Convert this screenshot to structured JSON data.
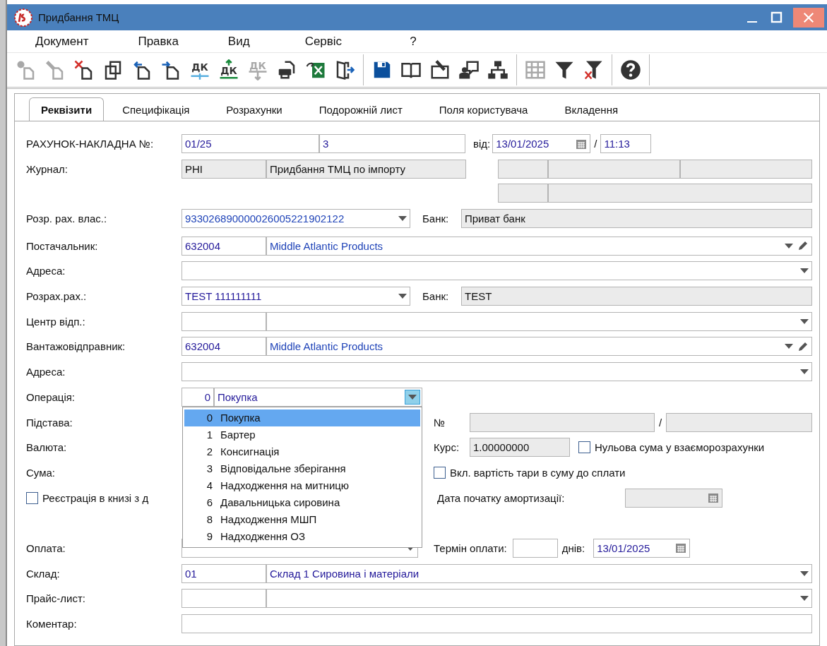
{
  "window": {
    "title": "Придбання ТМЦ"
  },
  "menu": [
    "Документ",
    "Правка",
    "Вид",
    "Сервіс",
    "?"
  ],
  "toolbar": [
    {
      "kind": "new",
      "disabled": true
    },
    {
      "kind": "edit",
      "disabled": true
    },
    {
      "kind": "delete",
      "disabled": false
    },
    {
      "kind": "copy",
      "disabled": false
    },
    {
      "kind": "import",
      "disabled": false
    },
    {
      "kind": "export",
      "disabled": false
    },
    {
      "kind": "dk-split",
      "label": "ДК",
      "disabled": false
    },
    {
      "kind": "dk-up",
      "label": "ДК",
      "disabled": false
    },
    {
      "kind": "dk-down",
      "label": "ДК",
      "disabled": true
    },
    {
      "kind": "print",
      "disabled": false
    },
    {
      "kind": "excel",
      "disabled": false
    },
    {
      "kind": "exit",
      "disabled": false
    },
    {
      "kind": "separator"
    },
    {
      "kind": "save",
      "disabled": false
    },
    {
      "kind": "book",
      "disabled": false
    },
    {
      "kind": "edit-doc",
      "disabled": false
    },
    {
      "kind": "comment",
      "disabled": false
    },
    {
      "kind": "hierarchy",
      "disabled": false
    },
    {
      "kind": "separator"
    },
    {
      "kind": "grid",
      "disabled": true
    },
    {
      "kind": "filter",
      "disabled": false
    },
    {
      "kind": "filter-clear",
      "disabled": false
    },
    {
      "kind": "separator"
    },
    {
      "kind": "help",
      "disabled": false
    },
    {
      "kind": "separator"
    }
  ],
  "tabs": [
    {
      "label": "Реквізити",
      "selected": true
    },
    {
      "label": "Специфікація",
      "selected": false
    },
    {
      "label": "Розрахунки",
      "selected": false
    },
    {
      "label": "Подорожній лист",
      "selected": false
    },
    {
      "label": "Поля користувача",
      "selected": false
    },
    {
      "label": "Вкладення",
      "selected": false
    }
  ],
  "invoice": {
    "label": "РАХУНОК-НАКЛАДНА №:",
    "number": "01/25",
    "suffix": "3",
    "date_label": "від:",
    "date": "13/01/2025",
    "separator": "/",
    "time": "11:13"
  },
  "journal": {
    "label": "Журнал:",
    "code": "РНІ",
    "name": "Придбання ТМЦ по імпорту"
  },
  "own_account": {
    "label": "Розр. рах. влас.:",
    "value": "933026890000026005221902122",
    "bank_label": "Банк:",
    "bank": "Приват банк"
  },
  "supplier": {
    "label": "Постачальник:",
    "code": "632004",
    "name": "Middle Atlantic Products"
  },
  "supplier_address": {
    "label": "Адреса:"
  },
  "account": {
    "label": "Розрах.рах.:",
    "value": "TEST 111111111",
    "bank_label": "Банк:",
    "bank": "TEST"
  },
  "responsibility_center": {
    "label": "Центр відп.:"
  },
  "shipper": {
    "label": "Вантажовідправник:",
    "code": "632004",
    "name": "Middle Atlantic Products"
  },
  "shipper_address": {
    "label": "Адреса:"
  },
  "operation": {
    "label": "Операція:",
    "code": "0",
    "name": "Покупка",
    "expanded": true,
    "options": [
      {
        "code": "0",
        "name": "Покупка",
        "selected": true
      },
      {
        "code": "1",
        "name": "Бартер",
        "selected": false
      },
      {
        "code": "2",
        "name": "Консигнація",
        "selected": false
      },
      {
        "code": "3",
        "name": "Відповідальне зберігання",
        "selected": false
      },
      {
        "code": "4",
        "name": "Надходження на митницю",
        "selected": false
      },
      {
        "code": "6",
        "name": "Давальницька сировина",
        "selected": false
      },
      {
        "code": "8",
        "name": "Надходження МШП",
        "selected": false
      },
      {
        "code": "9",
        "name": "Надходження ОЗ",
        "selected": false
      }
    ]
  },
  "basis": {
    "label": "Підстава:",
    "number_label": "№",
    "separator": "/"
  },
  "currency": {
    "label": "Валюта:",
    "rate_label": "Курс:",
    "rate": "1.00000000",
    "zero_sum": {
      "label": "Нульова сума у взаєморозрахунки",
      "checked": false
    }
  },
  "sum": {
    "label": "Сума:",
    "include_tare": {
      "label": "Вкл. вартість тари в суму до сплати",
      "checked": false
    }
  },
  "registration": {
    "label": "Реєстрація в книзі з д",
    "checked": false
  },
  "amortization": {
    "label": "Дата початку амортизації:"
  },
  "payment": {
    "label": "Оплата:",
    "term_label": "Термін оплати:",
    "days_label": "днів:",
    "due_date": "13/01/2025"
  },
  "warehouse": {
    "label": "Склад:",
    "code": "01",
    "name": "Склад 1 Сировина і матеріали"
  },
  "price_list": {
    "label": "Прайс-лист:"
  },
  "comment": {
    "label": "Коментар:"
  }
}
